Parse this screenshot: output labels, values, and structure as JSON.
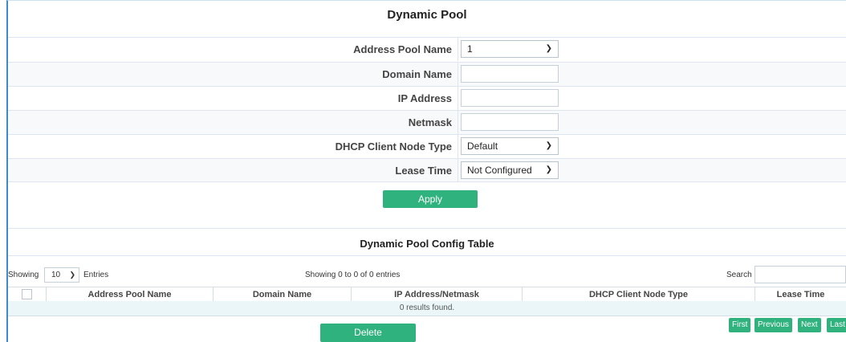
{
  "form": {
    "title": "Dynamic Pool",
    "fields": {
      "address_pool_name": {
        "label": "Address Pool Name",
        "value": "1"
      },
      "domain_name": {
        "label": "Domain Name",
        "value": ""
      },
      "ip_address": {
        "label": "IP Address",
        "value": ""
      },
      "netmask": {
        "label": "Netmask",
        "value": ""
      },
      "dhcp_client_node_type": {
        "label": "DHCP Client Node Type",
        "value": "Default"
      },
      "lease_time": {
        "label": "Lease Time",
        "value": "Not Configured"
      }
    },
    "apply_label": "Apply"
  },
  "table": {
    "title": "Dynamic Pool Config Table",
    "showing_label": "Showing",
    "entries_value": "10",
    "entries_label": "Entries",
    "info": "Showing 0 to 0 of 0 entries",
    "search_label": "Search",
    "search_value": "",
    "columns": [
      "Address Pool Name",
      "Domain Name",
      "IP Address/Netmask",
      "DHCP Client Node Type",
      "Lease Time"
    ],
    "empty_text": "0 results found.",
    "delete_label": "Delete",
    "pagination": {
      "first": "First",
      "previous": "Previous",
      "next": "Next",
      "last": "Last"
    }
  },
  "colors": {
    "accent": "#2fb27d",
    "frame": "#3a8ccf",
    "row_highlight": "#eaf6f8"
  }
}
